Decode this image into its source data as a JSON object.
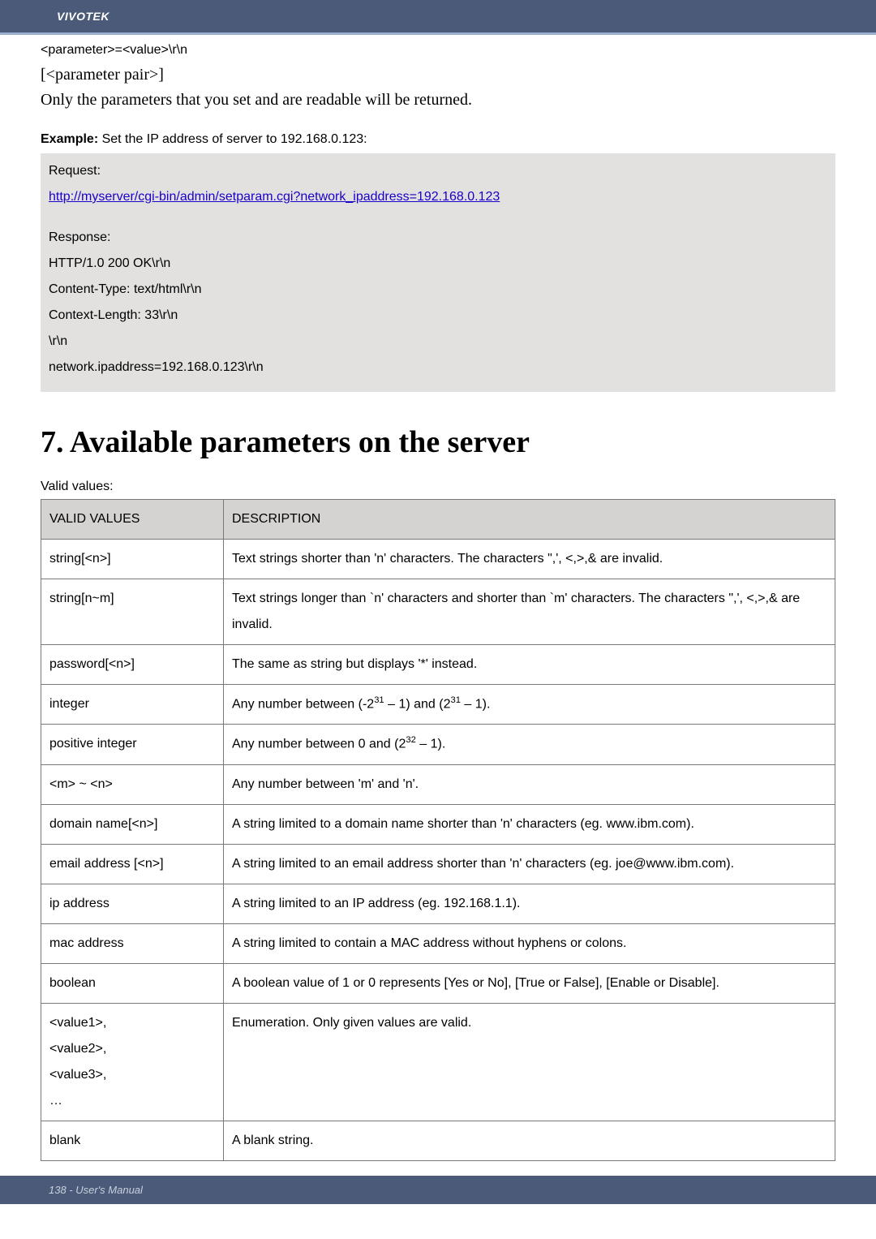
{
  "header": {
    "brand": "VIVOTEK"
  },
  "intro": {
    "line1": "<parameter>=<value>\\r\\n",
    "line2": "[<parameter pair>]",
    "line3": "Only the parameters that you set and are readable will be returned."
  },
  "example": {
    "label": "Example:",
    "text": "Set the IP address of server to 192.168.0.123:",
    "box": {
      "request_label": "Request:",
      "request_url": "http://myserver/cgi-bin/admin/setparam.cgi?network_ipaddress=192.168.0.123",
      "response_label": "Response:",
      "response_lines": [
        "HTTP/1.0 200 OK\\r\\n",
        "Content-Type: text/html\\r\\n",
        "Context-Length: 33\\r\\n",
        "\\r\\n",
        "network.ipaddress=192.168.0.123\\r\\n"
      ]
    }
  },
  "section": {
    "title": "7. Available parameters on the server",
    "sub": "Valid values:"
  },
  "table": {
    "headers": {
      "col1": "VALID VALUES",
      "col2": "DESCRIPTION"
    },
    "rows": [
      {
        "v": "string[<n>]",
        "d": "Text strings shorter than 'n' characters. The characters \",', <,>,& are invalid."
      },
      {
        "v": "string[n~m]",
        "d": "Text strings longer than `n' characters and shorter than `m' characters. The characters \",', <,>,& are invalid."
      },
      {
        "v": "password[<n>]",
        "d": "The same as string but displays '*' instead."
      },
      {
        "v": "integer",
        "d_html": "Any number between (-2<sup>31</sup> – 1) and (2<sup>31</sup> – 1)."
      },
      {
        "v": "positive integer",
        "d_html": "Any number between 0 and (2<sup>32</sup> – 1)."
      },
      {
        "v": "<m> ~ <n>",
        "d": "Any number between 'm' and 'n'."
      },
      {
        "v": "domain name[<n>]",
        "d": "A string limited to a domain name shorter than 'n' characters (eg. www.ibm.com)."
      },
      {
        "v": "email address [<n>]",
        "d": "A string limited to an email address shorter than 'n' characters (eg. joe@www.ibm.com)."
      },
      {
        "v": "ip address",
        "d": "A string limited to an IP address (eg. 192.168.1.1)."
      },
      {
        "v": "mac address",
        "d": "A string limited to contain a MAC address without hyphens or colons."
      },
      {
        "v": "boolean",
        "d": "A boolean value of 1 or 0 represents [Yes or No], [True or False], [Enable or Disable]."
      },
      {
        "v_html": "&lt;value1&gt;,<br>&lt;value2&gt;,<br>&lt;value3&gt;,<br>…",
        "d": "Enumeration. Only given values are valid."
      },
      {
        "v": "blank",
        "d": "A blank string."
      }
    ]
  },
  "footer": {
    "text": "138 - User's Manual"
  }
}
